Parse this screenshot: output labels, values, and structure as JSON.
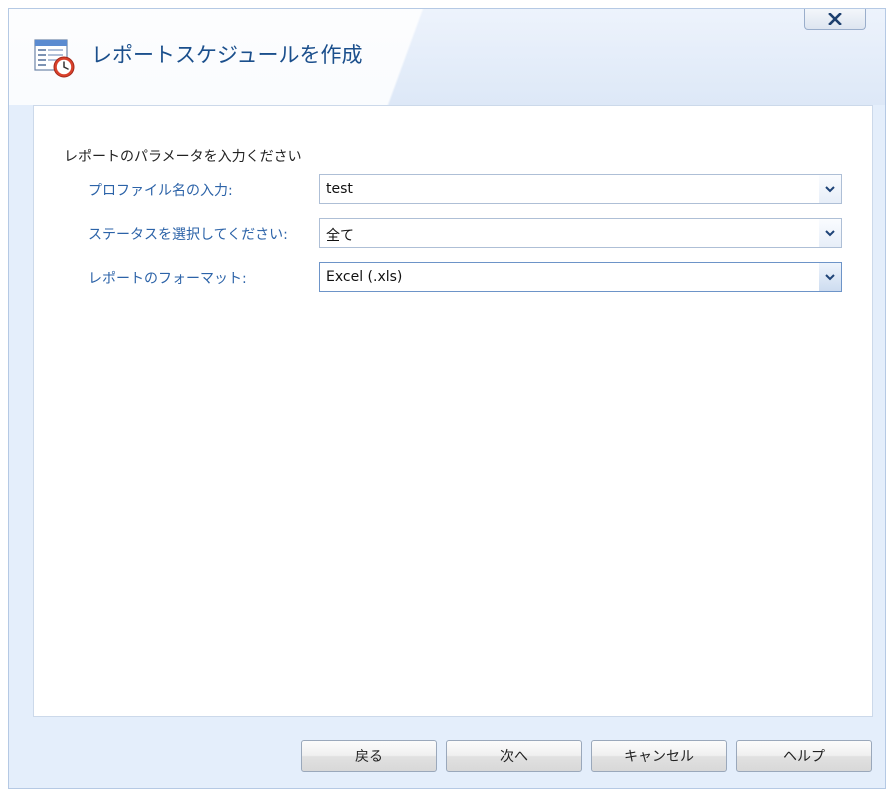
{
  "dialog": {
    "title": "レポートスケジュールを作成",
    "icon": "report-schedule-icon",
    "close_icon": "close-icon"
  },
  "form": {
    "intro": "レポートのパラメータを入力ください",
    "fields": [
      {
        "label": "プロファイル名の入力:",
        "value": "test"
      },
      {
        "label": "ステータスを選択してください:",
        "value": "全て"
      },
      {
        "label": "レポートのフォーマット:",
        "value": "Excel (.xls)"
      }
    ]
  },
  "buttons": {
    "back": "戻る",
    "next": "次へ",
    "cancel": "キャンセル",
    "help": "ヘルプ"
  },
  "colors": {
    "title": "#1b4f8c",
    "label": "#2c63a8",
    "dialog_bg": "#e4eefb"
  }
}
